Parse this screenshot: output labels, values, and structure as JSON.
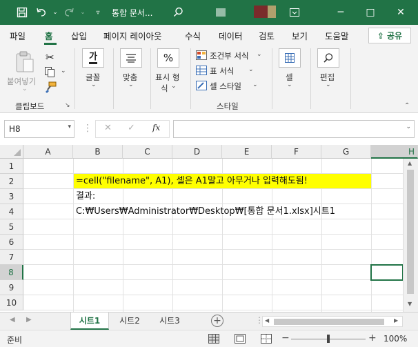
{
  "titlebar": {
    "title": "통합 문서...",
    "window_controls": [
      "─",
      "□",
      "✕"
    ]
  },
  "tabs": [
    "파일",
    "홈",
    "삽입",
    "페이지 레이아웃",
    "수식",
    "데이터",
    "검토",
    "보기",
    "도움말"
  ],
  "share_label": "공유",
  "ribbon": {
    "paste_label": "붙여넣기",
    "clipboard_label": "클립보드",
    "font_label": "글꼴",
    "align_label": "맞춤",
    "number_label_1": "표시 형",
    "number_label_2": "식",
    "cond_format": "조건부 서식",
    "table_format": "표 서식",
    "cell_style": "셀 스타일",
    "style_label": "스타일",
    "cells_label": "셀",
    "edit_label": "편집"
  },
  "formula_bar": {
    "name_box": "H8",
    "cancel": "✕",
    "enter": "✓",
    "fx": "fx",
    "value": ""
  },
  "grid": {
    "columns": [
      "A",
      "B",
      "C",
      "D",
      "E",
      "F",
      "G",
      "H"
    ],
    "rows": [
      "1",
      "2",
      "3",
      "4",
      "5",
      "6",
      "7",
      "8",
      "9",
      "10"
    ],
    "cells": {
      "B2": "=cell(\"filename\", A1), 셀은 A1말고 아무거나 입력해도됨!",
      "B3": "결과:",
      "B4": "C:₩Users₩Administrator₩Desktop₩[통합 문서1.xlsx]시트1"
    },
    "selected_cell": "H8",
    "highlight_color": "#ffff00"
  },
  "sheets": [
    "시트1",
    "시트2",
    "시트3"
  ],
  "active_sheet": "시트1",
  "status": {
    "ready": "준비",
    "zoom": "100%",
    "minus": "−",
    "plus": "+"
  },
  "colors": {
    "accent": "#217346"
  }
}
